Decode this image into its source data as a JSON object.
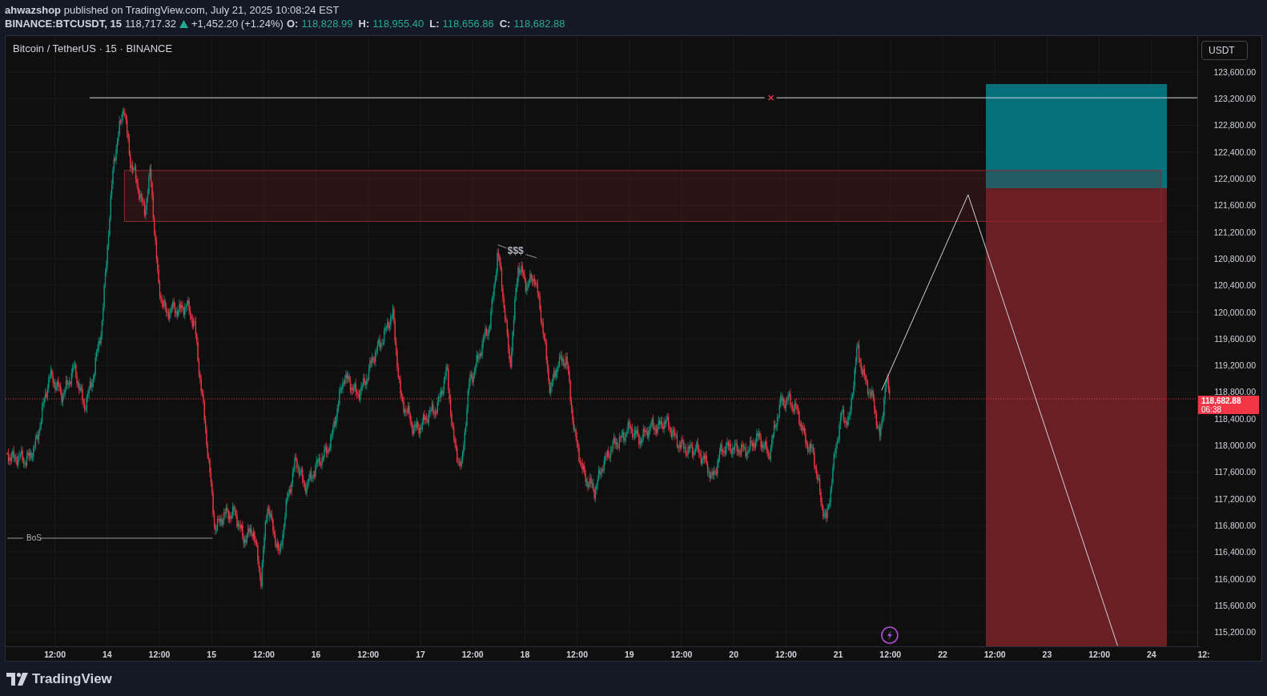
{
  "header": {
    "byline": "**ahwazshop** published on TradingView.com, July 21, 2025 10:08:24 EST",
    "symbol": "BINANCE:BTCUSDT, 15",
    "last": "118,717.32",
    "rising": true,
    "change": "+1,452.20 (+1.24%)",
    "ohlc": [
      {
        "label": "O:",
        "value": "118,828.99"
      },
      {
        "label": "H:",
        "value": "118,955.40"
      },
      {
        "label": "L:",
        "value": "118,656.86"
      },
      {
        "label": "C:",
        "value": "118,682.88"
      }
    ]
  },
  "chart": {
    "title": "Bitcoin / TetherUS · 15 · BINANCE",
    "currency_button": "USDT",
    "price_ticks": [
      "123,600.00",
      "123,200.00",
      "122,800.00",
      "122,400.00",
      "122,000.00",
      "121,600.00",
      "121,200.00",
      "120,800.00",
      "120,400.00",
      "120,000.00",
      "119,600.00",
      "119,200.00",
      "118,800.00",
      "118,400.00",
      "118,000.00",
      "117,600.00",
      "117,200.00",
      "116,800.00",
      "116,400.00",
      "116,000.00",
      "115,600.00",
      "115,200.00"
    ],
    "time_ticks": [
      "12:00",
      "14",
      "12:00",
      "15",
      "12:00",
      "16",
      "12:00",
      "17",
      "12:00",
      "18",
      "12:00",
      "19",
      "12:00",
      "20",
      "12:00",
      "21",
      "12:00",
      "22",
      "12:00",
      "23",
      "12:00",
      "24",
      "12:"
    ],
    "current_price": {
      "price": "118,682.88",
      "countdown": "06:38"
    },
    "liquidity_label": "$$$",
    "bos_label": "BoS"
  },
  "footer": {
    "brand": "TradingView"
  }
}
